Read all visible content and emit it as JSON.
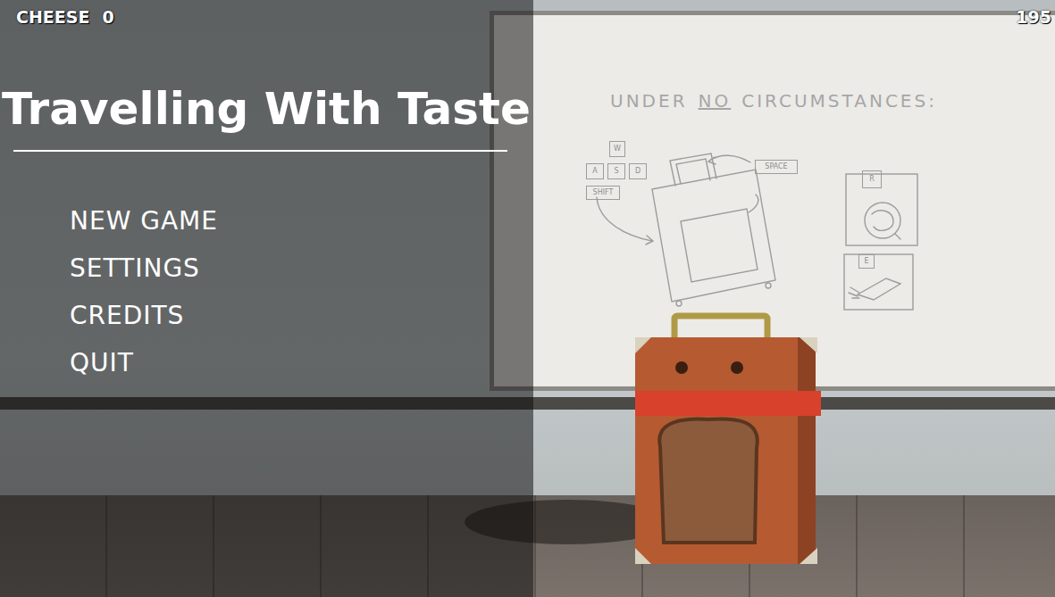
{
  "hud": {
    "cheese_label": "CHEESE",
    "cheese_count": "0",
    "counter": "195"
  },
  "title": "Travelling With Taste",
  "menu": [
    {
      "label": "NEW GAME"
    },
    {
      "label": "SETTINGS"
    },
    {
      "label": "CREDITS"
    },
    {
      "label": "QUIT"
    }
  ],
  "whiteboard": {
    "heading": {
      "before": "UNDER",
      "emphasis": "NO",
      "after": "CIRCUMSTANCES:"
    },
    "keys": [
      {
        "label": "W"
      },
      {
        "label": "A"
      },
      {
        "label": "S"
      },
      {
        "label": "D"
      },
      {
        "label": "SHIFT"
      },
      {
        "label": "SPACE"
      },
      {
        "label": "R"
      },
      {
        "label": "E"
      }
    ]
  }
}
